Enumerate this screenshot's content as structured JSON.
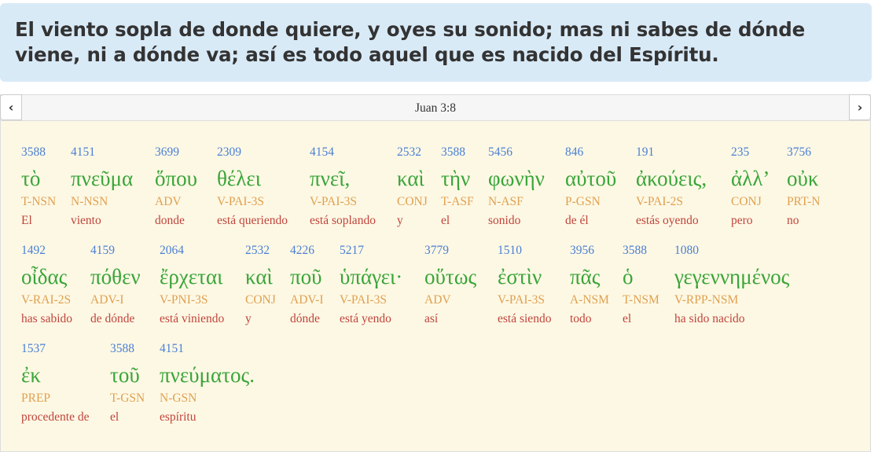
{
  "verse": {
    "text": "El viento sopla de donde quiere, y oyes su sonido; mas ni sabes de dónde viene, ni a dónde va; así es todo aquel que es nacido del Espíritu."
  },
  "nav": {
    "reference": "Juan 3:8",
    "prev_icon": "chevron-left-icon",
    "next_icon": "chevron-right-icon",
    "prev_glyph": "‹",
    "next_glyph": "›"
  },
  "rows": [
    [
      {
        "num": "3588",
        "greek": "τὸ",
        "parse": "T-NSN",
        "trans": "El"
      },
      {
        "num": "4151",
        "greek": "πνεῦμα",
        "parse": "N-NSN",
        "trans": "viento"
      },
      {
        "num": "3699",
        "greek": "ὅπου",
        "parse": "ADV",
        "trans": "donde"
      },
      {
        "num": "2309",
        "greek": "θέλει",
        "parse": "V-PAI-3S",
        "trans": "está queriendo"
      },
      {
        "num": "4154",
        "greek": "πνεῖ,",
        "parse": "V-PAI-3S",
        "trans": "está soplando"
      },
      {
        "num": "2532",
        "greek": "καὶ",
        "parse": "CONJ",
        "trans": "y"
      },
      {
        "num": "3588",
        "greek": "τὴν",
        "parse": "T-ASF",
        "trans": "el"
      },
      {
        "num": "5456",
        "greek": "φωνὴν",
        "parse": "N-ASF",
        "trans": "sonido"
      },
      {
        "num": "846",
        "greek": "αὐτοῦ",
        "parse": "P-GSN",
        "trans": "de él"
      },
      {
        "num": "191",
        "greek": "ἀκούεις,",
        "parse": "V-PAI-2S",
        "trans": "estás oyendo"
      },
      {
        "num": "235",
        "greek": "ἀλλ’",
        "parse": "CONJ",
        "trans": "pero"
      },
      {
        "num": "3756",
        "greek": "οὐκ",
        "parse": "PRT-N",
        "trans": "no"
      }
    ],
    [
      {
        "num": "1492",
        "greek": "οἶδας",
        "parse": "V-RAI-2S",
        "trans": "has sabido"
      },
      {
        "num": "4159",
        "greek": "πόθεν",
        "parse": "ADV-I",
        "trans": "de dónde"
      },
      {
        "num": "2064",
        "greek": "ἔρχεται",
        "parse": "V-PNI-3S",
        "trans": "está viniendo"
      },
      {
        "num": "2532",
        "greek": "καὶ",
        "parse": "CONJ",
        "trans": "y"
      },
      {
        "num": "4226",
        "greek": "ποῦ",
        "parse": "ADV-I",
        "trans": "dónde"
      },
      {
        "num": "5217",
        "greek": "ὑπάγει·",
        "parse": "V-PAI-3S",
        "trans": "está yendo"
      },
      {
        "num": "3779",
        "greek": "οὕτως",
        "parse": "ADV",
        "trans": "así"
      },
      {
        "num": "1510",
        "greek": "ἐστὶν",
        "parse": "V-PAI-3S",
        "trans": "está siendo"
      },
      {
        "num": "3956",
        "greek": "πᾶς",
        "parse": "A-NSM",
        "trans": "todo"
      },
      {
        "num": "3588",
        "greek": "ὁ",
        "parse": "T-NSM",
        "trans": "el"
      },
      {
        "num": "1080",
        "greek": "γεγεννημένος",
        "parse": "V-RPP-NSM",
        "trans": "ha sido nacido"
      }
    ],
    [
      {
        "num": "1537",
        "greek": "ἐκ",
        "parse": "PREP",
        "trans": "procedente de"
      },
      {
        "num": "3588",
        "greek": "τοῦ",
        "parse": "T-GSN",
        "trans": "el"
      },
      {
        "num": "4151",
        "greek": "πνεύματος.",
        "parse": "N-GSN",
        "trans": "espíritu"
      }
    ]
  ],
  "colors": {
    "strongs_number": "#4a7fd4",
    "greek": "#3aa53a",
    "parsing": "#e0a050",
    "translation": "#c0443c",
    "banner_bg": "#d9eaf7",
    "panel_bg": "#fdf8e4"
  }
}
